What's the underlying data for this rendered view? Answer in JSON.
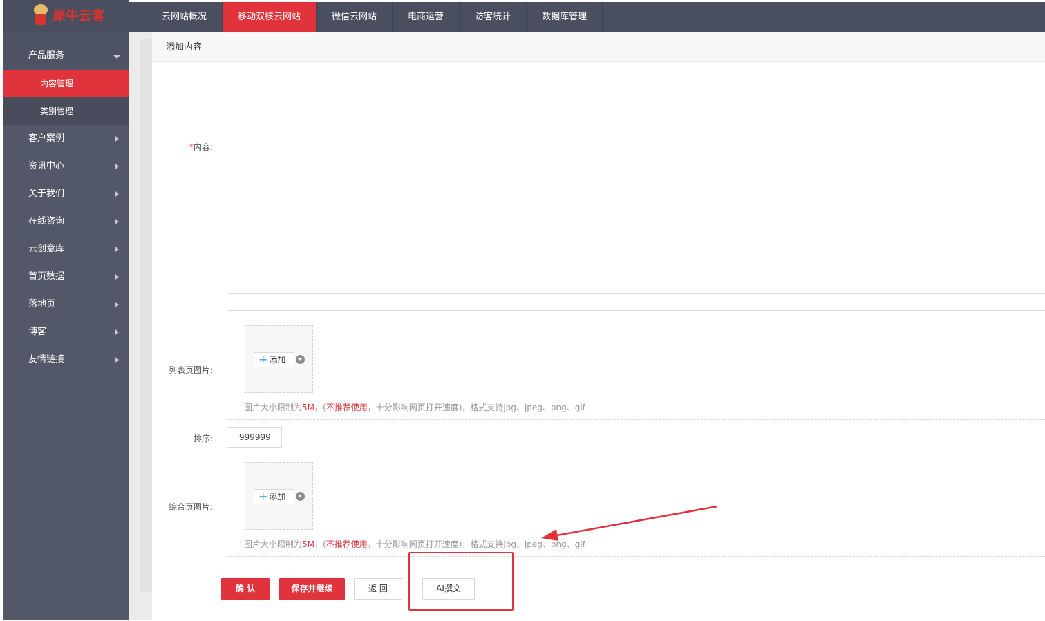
{
  "brand": {
    "logo_text": "犀牛云客"
  },
  "top_nav": {
    "tabs": [
      {
        "label": "云网站概况",
        "active": false
      },
      {
        "label": "移动双核云网站",
        "active": true
      },
      {
        "label": "微信云网站",
        "active": false
      },
      {
        "label": "电商运营",
        "active": false
      },
      {
        "label": "访客统计",
        "active": false
      },
      {
        "label": "数据库管理",
        "active": false
      }
    ]
  },
  "sidebar": {
    "group_open": {
      "label": "产品服务",
      "items": [
        {
          "label": "内容管理",
          "active": true
        },
        {
          "label": "类别管理",
          "active": false
        }
      ]
    },
    "items": [
      {
        "label": "客户案例"
      },
      {
        "label": "资讯中心"
      },
      {
        "label": "关于我们"
      },
      {
        "label": "在线咨询"
      },
      {
        "label": "云创意库"
      },
      {
        "label": "首页数据"
      },
      {
        "label": "落地页"
      },
      {
        "label": "博客"
      },
      {
        "label": "友情链接"
      }
    ]
  },
  "page": {
    "title": "添加内容"
  },
  "form": {
    "content": {
      "required_mark": "*",
      "label": "内容:"
    },
    "list_image": {
      "label": "列表页图片:",
      "add_label": "添加",
      "hint_prefix": "图片大小限制为",
      "hint_size": "5M",
      "hint_sep": "，(",
      "hint_warn": "不推荐使用",
      "hint_suffix": "，十分影响网页打开速度)，格式支持jpg、jpeg、png、gif"
    },
    "sort": {
      "label": "排序:",
      "value": "999999"
    },
    "composite_image": {
      "label": "综合页图片:",
      "add_label": "添加",
      "hint_prefix": "图片大小限制为",
      "hint_size": "5M",
      "hint_sep": "，(",
      "hint_warn": "不推荐使用",
      "hint_suffix": "，十分影响网页打开速度)，格式支持jpg、jpeg、png、gif"
    }
  },
  "actions": {
    "confirm": "确 认",
    "save_continue": "保存并继续",
    "back": "返 回",
    "ai_write": "AI撰文"
  },
  "colors": {
    "accent": "#e0333b",
    "sidebar": "#535868",
    "topbar": "#4a4f60"
  }
}
